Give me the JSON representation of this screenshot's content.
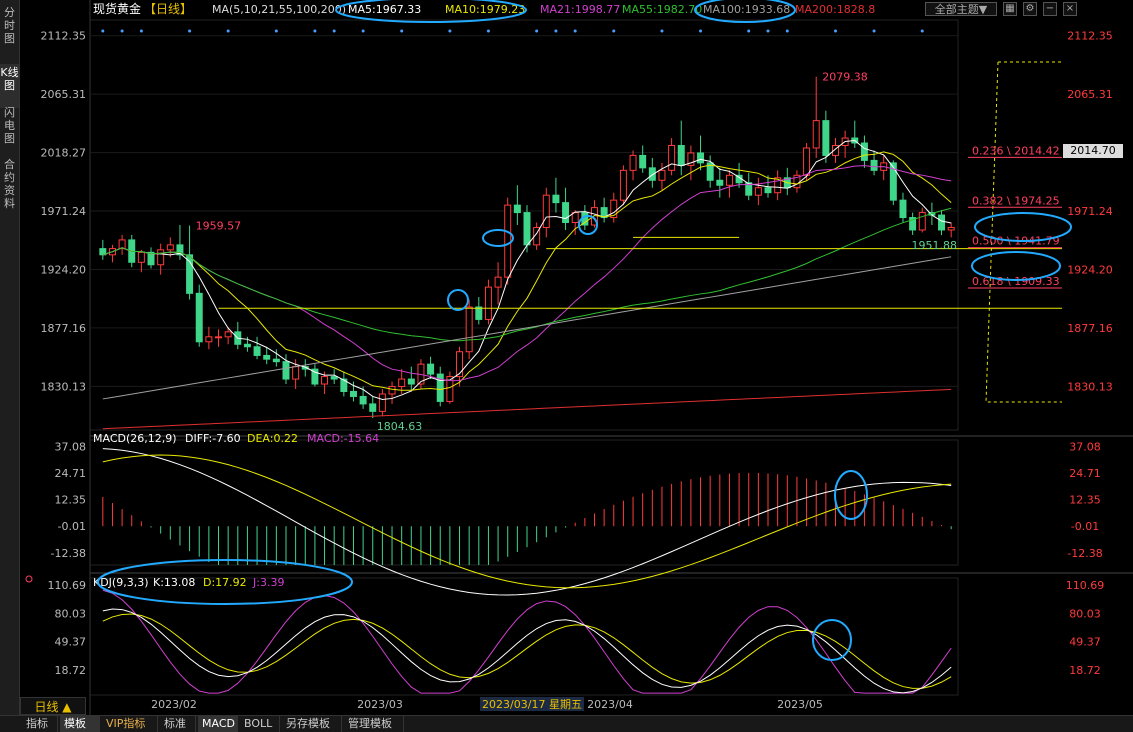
{
  "left_tabs": [
    {
      "label": "分时图",
      "active": false
    },
    {
      "label": "K线图",
      "active": true
    },
    {
      "label": "闪电图",
      "active": false
    },
    {
      "label": "合约资料",
      "active": false
    }
  ],
  "header": {
    "instrument": "现货黄金",
    "period_tag": "【日线】",
    "ma_params": "MA(5,10,21,55,100,200)",
    "ma": [
      {
        "label": "MA5:1967.33",
        "color": "#ffffff"
      },
      {
        "label": "MA10:1979.23",
        "color": "#e8e800"
      },
      {
        "label": "MA21:1998.77",
        "color": "#d040d0"
      },
      {
        "label": "MA55:1982.70",
        "color": "#30c030"
      },
      {
        "label": "MA100:1933.68",
        "color": "#a0a0a0"
      },
      {
        "label": "MA200:1828.8",
        "color": "#e03030"
      }
    ],
    "theme_button": "全部主题▼",
    "current_price": "2014.70"
  },
  "chart_data": {
    "type": "candlestick",
    "price_axis_ticks": [
      "2112.35",
      "2065.31",
      "2018.27",
      "1971.24",
      "1924.20",
      "1877.16",
      "1830.13"
    ],
    "x_tick_labels": [
      "2023/02",
      "2023/03",
      "2023/04",
      "2023/05"
    ],
    "crosshair_label": "2023/03/17 星期五",
    "ylim": [
      1795,
      2125
    ],
    "candles": [
      [
        1941,
        1948,
        1932,
        1936
      ],
      [
        1936,
        1944,
        1930,
        1941
      ],
      [
        1941,
        1952,
        1936,
        1948
      ],
      [
        1948,
        1952,
        1926,
        1930
      ],
      [
        1930,
        1940,
        1922,
        1938
      ],
      [
        1938,
        1942,
        1925,
        1928
      ],
      [
        1928,
        1945,
        1920,
        1940
      ],
      [
        1940,
        1950,
        1934,
        1944
      ],
      [
        1944,
        1960,
        1932,
        1936
      ],
      [
        1936,
        1959.57,
        1900,
        1905
      ],
      [
        1905,
        1912,
        1862,
        1866
      ],
      [
        1866,
        1878,
        1860,
        1870
      ],
      [
        1870,
        1876,
        1862,
        1870
      ],
      [
        1870,
        1878,
        1864,
        1874
      ],
      [
        1874,
        1882,
        1860,
        1864
      ],
      [
        1864,
        1870,
        1858,
        1862
      ],
      [
        1862,
        1870,
        1852,
        1855
      ],
      [
        1855,
        1862,
        1848,
        1852
      ],
      [
        1852,
        1860,
        1846,
        1850
      ],
      [
        1850,
        1856,
        1832,
        1836
      ],
      [
        1836,
        1852,
        1828,
        1846
      ],
      [
        1846,
        1852,
        1838,
        1844
      ],
      [
        1844,
        1848,
        1830,
        1832
      ],
      [
        1832,
        1842,
        1824,
        1838
      ],
      [
        1838,
        1844,
        1832,
        1836
      ],
      [
        1836,
        1842,
        1822,
        1826
      ],
      [
        1826,
        1834,
        1818,
        1822
      ],
      [
        1822,
        1830,
        1812,
        1816
      ],
      [
        1816,
        1822,
        1804.63,
        1810
      ],
      [
        1810,
        1828,
        1806,
        1824
      ],
      [
        1824,
        1834,
        1816,
        1830
      ],
      [
        1830,
        1844,
        1824,
        1836
      ],
      [
        1836,
        1846,
        1826,
        1832
      ],
      [
        1832,
        1852,
        1828,
        1848
      ],
      [
        1848,
        1854,
        1836,
        1840
      ],
      [
        1840,
        1846,
        1814,
        1818
      ],
      [
        1818,
        1842,
        1816,
        1838
      ],
      [
        1838,
        1862,
        1830,
        1858
      ],
      [
        1858,
        1900,
        1852,
        1894
      ],
      [
        1894,
        1902,
        1880,
        1884
      ],
      [
        1884,
        1916,
        1880,
        1910
      ],
      [
        1910,
        1930,
        1896,
        1918
      ],
      [
        1918,
        1982,
        1912,
        1976
      ],
      [
        1976,
        1992,
        1960,
        1970
      ],
      [
        1970,
        1976,
        1938,
        1944
      ],
      [
        1944,
        1962,
        1940,
        1958
      ],
      [
        1958,
        1990,
        1950,
        1984
      ],
      [
        1984,
        1998,
        1970,
        1978
      ],
      [
        1978,
        1990,
        1956,
        1962
      ],
      [
        1962,
        1972,
        1952,
        1970
      ],
      [
        1970,
        1976,
        1956,
        1960
      ],
      [
        1960,
        1980,
        1958,
        1974
      ],
      [
        1974,
        1982,
        1962,
        1966
      ],
      [
        1966,
        1986,
        1962,
        1980
      ],
      [
        1980,
        2008,
        1976,
        2004
      ],
      [
        2004,
        2020,
        1996,
        2016
      ],
      [
        2016,
        2024,
        2002,
        2006
      ],
      [
        2006,
        2014,
        1990,
        1996
      ],
      [
        1996,
        2010,
        1988,
        2004
      ],
      [
        2004,
        2030,
        2000,
        2024
      ],
      [
        2024,
        2044,
        2000,
        2008
      ],
      [
        2008,
        2024,
        1996,
        2018
      ],
      [
        2018,
        2032,
        2004,
        2010
      ],
      [
        2010,
        2016,
        1990,
        1996
      ],
      [
        1996,
        2006,
        1982,
        1992
      ],
      [
        1992,
        2004,
        1982,
        2000
      ],
      [
        2000,
        2010,
        1990,
        1994
      ],
      [
        1994,
        2002,
        1980,
        1984
      ],
      [
        1984,
        1998,
        1976,
        1990
      ],
      [
        1990,
        2000,
        1982,
        1986
      ],
      [
        1986,
        2004,
        1980,
        1998
      ],
      [
        1998,
        2006,
        1984,
        1990
      ],
      [
        1990,
        2004,
        1986,
        2000
      ],
      [
        2000,
        2026,
        1996,
        2022
      ],
      [
        2022,
        2079.38,
        2014,
        2044
      ],
      [
        2044,
        2052,
        2010,
        2016
      ],
      [
        2016,
        2030,
        2010,
        2024
      ],
      [
        2024,
        2036,
        2014,
        2030
      ],
      [
        2030,
        2044,
        2022,
        2026
      ],
      [
        2026,
        2032,
        2006,
        2012
      ],
      [
        2012,
        2020,
        2000,
        2004
      ],
      [
        2004,
        2016,
        1996,
        2010
      ],
      [
        2010,
        2012,
        1976,
        1980
      ],
      [
        1980,
        1986,
        1962,
        1966
      ],
      [
        1966,
        1970,
        1952,
        1956
      ],
      [
        1956,
        1974,
        1954,
        1970
      ],
      [
        1970,
        1978,
        1960,
        1968
      ],
      [
        1968,
        1972,
        1951.88,
        1956
      ],
      [
        1956,
        1962,
        1950,
        1958
      ]
    ],
    "price_labels": [
      {
        "text": "2079.38",
        "color": "#ff4060"
      },
      {
        "text": "1959.57",
        "color": "#ff4060"
      },
      {
        "text": "1804.63",
        "color": "#60d090"
      },
      {
        "text": "1951.88",
        "color": "#60d090"
      }
    ],
    "fibonacci": [
      {
        "label": "0.236 \\ 2014.42",
        "value": 2014.42
      },
      {
        "label": "0.382 \\ 1974.25",
        "value": 1974.25
      },
      {
        "label": "0.500 \\ 1941.79",
        "value": 1941.79
      },
      {
        "label": "0.618 \\ 1909.33",
        "value": 1909.33
      }
    ],
    "horizontal_lines": [
      1941,
      1893
    ],
    "macd": {
      "header": "MACD(26,12,9)",
      "diff": "DIFF:-7.60",
      "dea": "DEA:0.22",
      "macd": "MACD:-15.64",
      "ticks": [
        "37.08",
        "24.71",
        "12.35",
        "-0.01",
        "-12.38"
      ],
      "ylim": [
        -18,
        40
      ]
    },
    "kdj": {
      "header": "KDJ(9,3,3)",
      "k": "K:13.08",
      "d": "D:17.92",
      "j": "J:3.39",
      "ticks": [
        "110.69",
        "80.03",
        "49.37",
        "18.72"
      ],
      "ylim": [
        -8,
        118
      ]
    }
  },
  "period_button": "日线 ▲",
  "bottom_tabs": [
    {
      "label": "指标",
      "active": false,
      "vip": false
    },
    {
      "label": "模板",
      "active": true,
      "vip": false
    },
    {
      "label": "VIP指标",
      "active": false,
      "vip": true
    },
    {
      "label": "标准",
      "active": false,
      "vip": false
    },
    {
      "label": "MACD",
      "active": true,
      "vip": false
    },
    {
      "label": "BOLL",
      "active": false,
      "vip": false
    },
    {
      "label": "另存模板",
      "active": false,
      "vip": false
    },
    {
      "label": "管理模板",
      "active": false,
      "vip": false
    }
  ],
  "colors": {
    "up": "#ff3b3b",
    "down": "#3fd68a",
    "ma5": "#ffffff",
    "ma10": "#e8e800",
    "ma21": "#d040d0",
    "ma55": "#30c030",
    "ma100": "#a0a0a0",
    "ma200": "#e03030",
    "fib": "#ff4060",
    "annot": "#22aaff"
  }
}
